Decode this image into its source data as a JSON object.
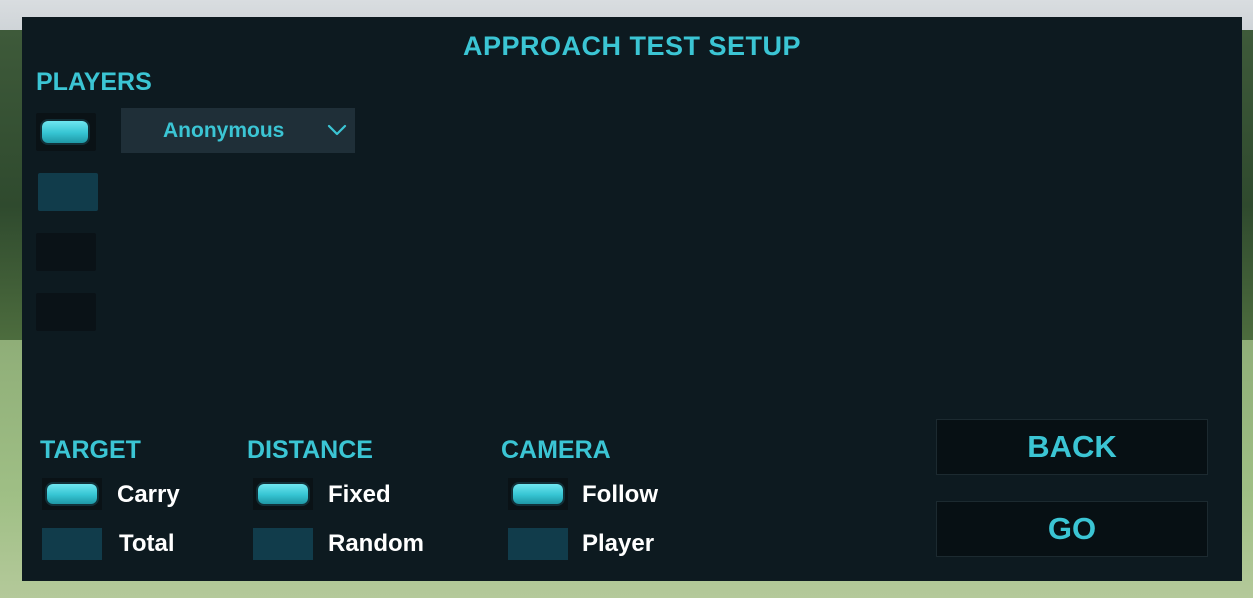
{
  "title": "APPROACH TEST SETUP",
  "players": {
    "label": "PLAYERS",
    "selected_player": "Anonymous",
    "icons": {
      "dropdown": "chevron-down-icon"
    }
  },
  "target": {
    "label": "TARGET",
    "options": [
      {
        "label": "Carry",
        "selected": true
      },
      {
        "label": "Total",
        "selected": false
      }
    ]
  },
  "distance": {
    "label": "DISTANCE",
    "options": [
      {
        "label": "Fixed",
        "selected": true
      },
      {
        "label": "Random",
        "selected": false
      }
    ]
  },
  "camera": {
    "label": "CAMERA",
    "options": [
      {
        "label": "Follow",
        "selected": true
      },
      {
        "label": "Player",
        "selected": false
      }
    ]
  },
  "buttons": {
    "back": "BACK",
    "go": "GO"
  },
  "colors": {
    "accent": "#3bc5d4",
    "panel_bg": "#0d1a20",
    "toggle_on": "#35c4d2",
    "toggle_off": "#113c4b",
    "text": "#ffffff"
  }
}
